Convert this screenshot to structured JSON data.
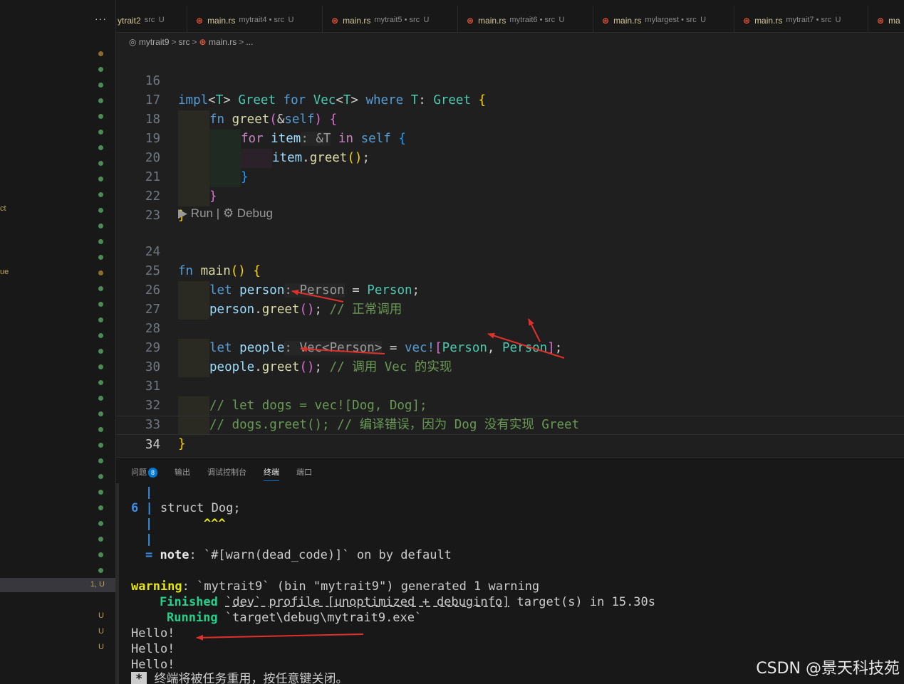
{
  "tabs": [
    {
      "name": "ytrait2",
      "desc": "src",
      "status": "U",
      "icon": "rust-icon"
    },
    {
      "name": "main.rs",
      "desc": "mytrait4 • src",
      "status": "U",
      "icon": "rust-icon"
    },
    {
      "name": "main.rs",
      "desc": "mytrait5 • src",
      "status": "U",
      "icon": "rust-icon"
    },
    {
      "name": "main.rs",
      "desc": "mytrait6 • src",
      "status": "U",
      "icon": "rust-icon"
    },
    {
      "name": "main.rs",
      "desc": "mylargest • src",
      "status": "U",
      "icon": "rust-icon"
    },
    {
      "name": "main.rs",
      "desc": "mytrait7 • src",
      "status": "U",
      "icon": "rust-icon"
    },
    {
      "name": "ma",
      "desc": "",
      "status": "",
      "icon": "rust-icon"
    }
  ],
  "sidebar": {
    "more": "···",
    "fragments": [
      "ct",
      "ue"
    ],
    "selected_status": "1, U",
    "u_markers": [
      "U",
      "U",
      "U"
    ]
  },
  "breadcrumb": {
    "folder": "mytrait9",
    "sub": "src",
    "file": "main.rs",
    "more": "..."
  },
  "editor": {
    "line_numbers": [
      "16",
      "17",
      "18",
      "19",
      "20",
      "21",
      "22",
      "23",
      "24",
      "25",
      "26",
      "27",
      "28",
      "29",
      "30",
      "31",
      "32",
      "33",
      "34"
    ],
    "codelens": "▶ Run | ⚙ Debug",
    "lines": {
      "l16": "impl<T> Greet for Vec<T> where T: Greet {",
      "l17": "fn greet(&self) {",
      "l18_kw": "for",
      "l18_var": "item",
      "l18_hint": ": &T",
      "l18_rest": "in self {",
      "l19": "item.greet();",
      "l20": "}",
      "l21": "}",
      "l22": "}",
      "l24": "fn main() {",
      "l25_kw": "let",
      "l25_var": "person",
      "l25_hint": ": Person",
      "l25_rest": "= Person;",
      "l26_code": "person.greet();",
      "l26_comment": "// 正常调用",
      "l28_kw": "let",
      "l28_var": "people",
      "l28_hint": ": Vec<Person>",
      "l28_rest_a": "= vec!",
      "l28_rest_b": "[Person, Person]",
      "l28_rest_c": ";",
      "l29_code": "people.greet();",
      "l29_comment": "// 调用 Vec 的实现",
      "l31": "// let dogs = vec![Dog, Dog];",
      "l32": "// dogs.greet(); // 编译错误，因为 Dog 没有实现 Greet",
      "l33": "}"
    }
  },
  "panel": {
    "tabs": [
      {
        "label": "问题",
        "badge": "8"
      },
      {
        "label": "输出"
      },
      {
        "label": "调试控制台"
      },
      {
        "label": "终端",
        "active": true
      },
      {
        "label": "端口"
      }
    ]
  },
  "terminal": {
    "pipe": "|",
    "line6_num": "6",
    "line6_code": "struct Dog;",
    "carets": "^^^",
    "note_eq": "=",
    "note_label": "note",
    "note_text": ": `#[warn(dead_code)]` on by default",
    "warn_label": "warning",
    "warn_text": ": `mytrait9` (bin \"mytrait9\") generated 1 warning",
    "finished_label": "Finished",
    "finished_text_a": "`dev` profile [unoptimized + debuginfo]",
    "finished_text_b": " target(s) in 15.30s",
    "running_label": "Running",
    "running_text": "`target\\debug\\mytrait9.exe`",
    "hello": [
      "Hello!",
      "Hello!",
      "Hello!"
    ],
    "star": "*",
    "reuse_msg": "终端将被任务重用，按任意键关闭。"
  },
  "watermark": "CSDN @景天科技苑",
  "colors": {
    "accent": "#0078d4",
    "arrow": "#e0302a",
    "rust": "#e8563c"
  }
}
